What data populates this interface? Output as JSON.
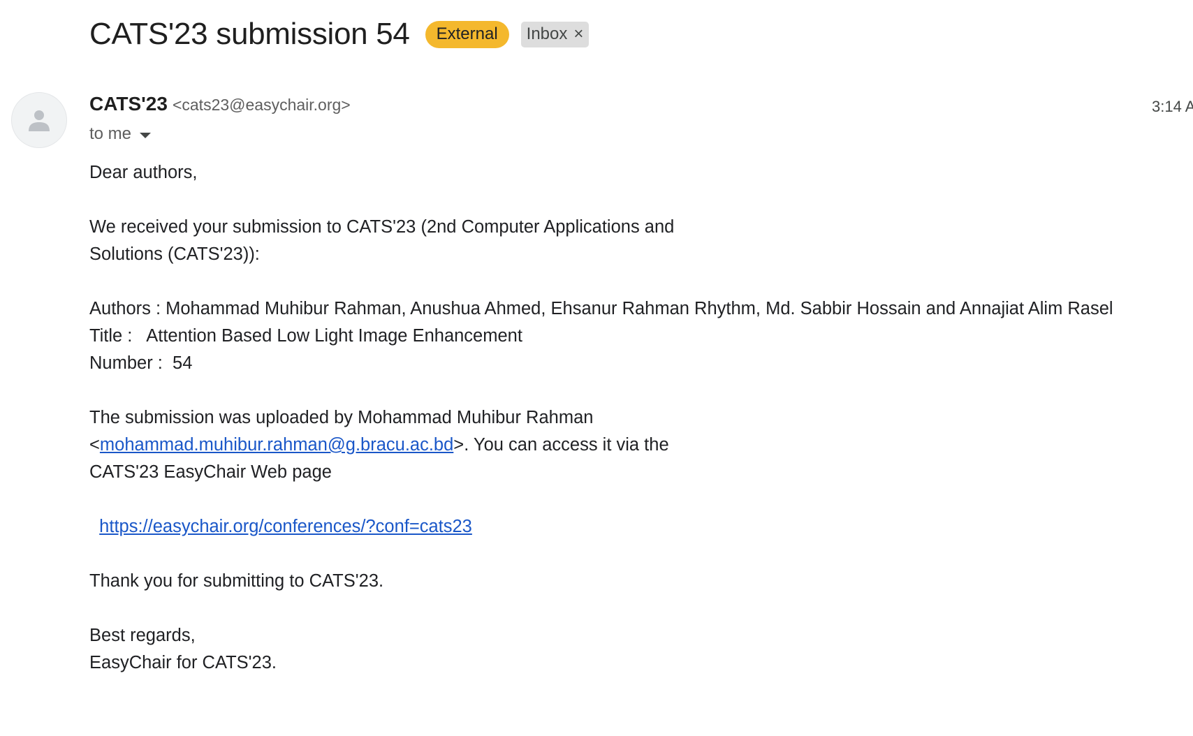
{
  "email": {
    "subject": "CATS'23 submission 54",
    "labels": {
      "external": "External",
      "inbox": "Inbox",
      "inbox_close": "×"
    },
    "sender": {
      "name": "CATS'23",
      "email": "<cats23@easychair.org>",
      "time": "3:14 A",
      "recipient": "to me"
    },
    "body": {
      "greeting": "Dear authors,",
      "received_line1": "We received your submission to CATS'23 (2nd Computer Applications and",
      "received_line2": "Solutions (CATS'23)):",
      "authors": "Authors : Mohammad Muhibur Rahman, Anushua Ahmed, Ehsanur Rahman Rhythm, Md. Sabbir Hossain and Annajiat Alim Rasel",
      "title": "Title :   Attention Based Low Light Image Enhancement",
      "number": "Number :  54",
      "uploaded_line1": "The submission was uploaded by Mohammad Muhibur Rahman",
      "uploader_open": "<",
      "uploader_email": "mohammad.muhibur.rahman@g.bracu.ac.bd",
      "uploaded_line2_rest": ">. You can access it via the",
      "uploaded_line3": "CATS'23 EasyChair Web page",
      "link_indent": "  ",
      "link": "https://easychair.org/conferences/?conf=cats23",
      "thanks": "Thank you for submitting to CATS'23.",
      "regards": "Best regards,",
      "signature": "EasyChair for CATS'23."
    }
  },
  "colors": {
    "external_label": "#f4b82d",
    "inbox_label": "#dddddd",
    "link": "#1a57c8"
  },
  "icons": {
    "avatar": "person-icon",
    "recipient_details": "caret-down-icon",
    "remove_label": "close-icon"
  }
}
